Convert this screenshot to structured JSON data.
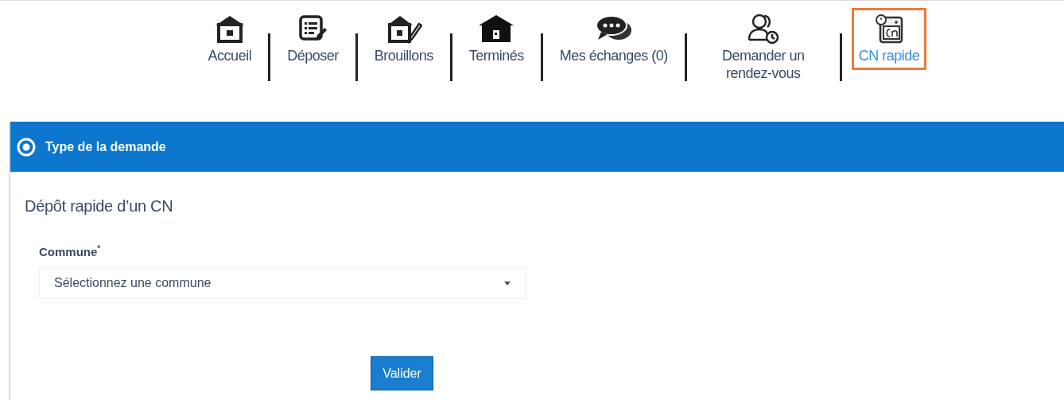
{
  "nav": [
    {
      "label": "Accueil",
      "selected": false
    },
    {
      "label": "Déposer",
      "selected": false
    },
    {
      "label": "Brouillons",
      "selected": false
    },
    {
      "label": "Terminés",
      "selected": false
    },
    {
      "label": "Mes échanges (0)",
      "selected": false
    },
    {
      "label": "Demander un rendez-vous",
      "selected": false
    },
    {
      "label": "CN rapide",
      "selected": true
    }
  ],
  "section": {
    "title": "Type de la demande"
  },
  "form": {
    "heading": "Dépôt rapide d’un CN",
    "field_label": "Commune",
    "required_mark": "*",
    "placeholder": "Sélectionnez une commune"
  },
  "buttons": [
    "Valider"
  ]
}
